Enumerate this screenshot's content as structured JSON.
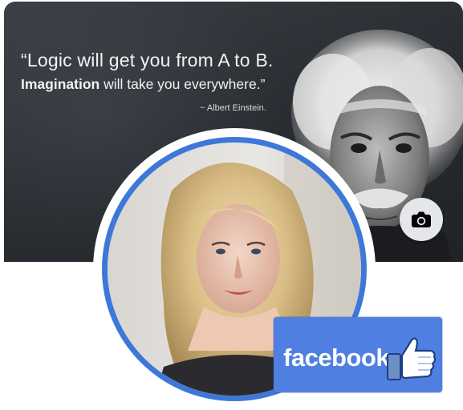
{
  "cover": {
    "quote_line1": "“Logic will get you from A to B.",
    "quote_line2_strong": "Imagination",
    "quote_line2_rest": " will take you everywhere.”",
    "quote_attribution": "~ Albert Einstein."
  },
  "cover_photo_button": {
    "icon": "camera-icon"
  },
  "profile": {
    "ring_color": "#3d78d8"
  },
  "facebook_badge": {
    "label": "facebook",
    "icon": "thumbs-up-icon",
    "background": "#4f7fe0"
  }
}
